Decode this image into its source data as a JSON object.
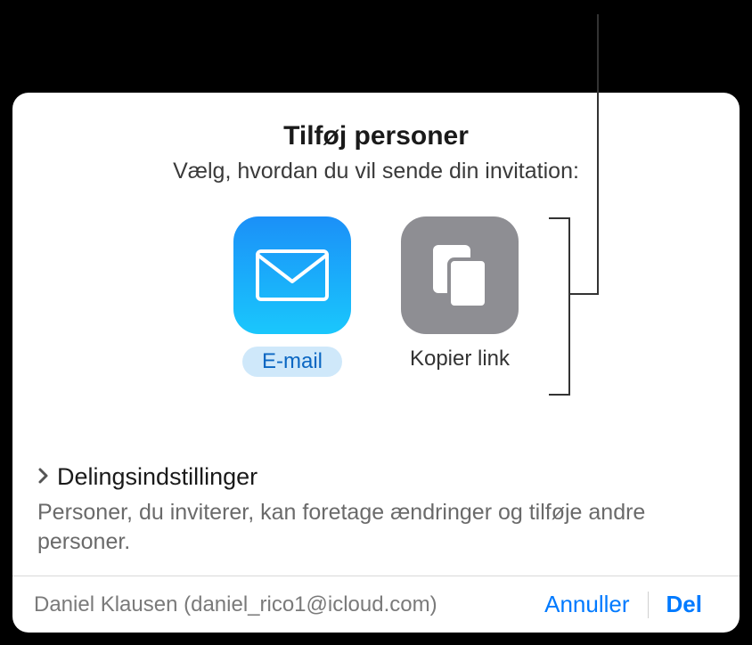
{
  "dialog": {
    "title": "Tilføj personer",
    "subtitle": "Vælg, hvordan du vil sende din invitation:"
  },
  "options": {
    "email": {
      "label": "E-mail",
      "selected": true,
      "icon": "mail-icon"
    },
    "copy_link": {
      "label": "Kopier link",
      "selected": false,
      "icon": "copy-icon"
    }
  },
  "settings": {
    "header": "Delingsindstillinger",
    "description": "Personer, du inviterer, kan foretage ændringer og tilføje andre personer."
  },
  "footer": {
    "user": "Daniel Klausen (daniel_rico1@icloud.com)",
    "cancel": "Annuller",
    "share": "Del"
  }
}
